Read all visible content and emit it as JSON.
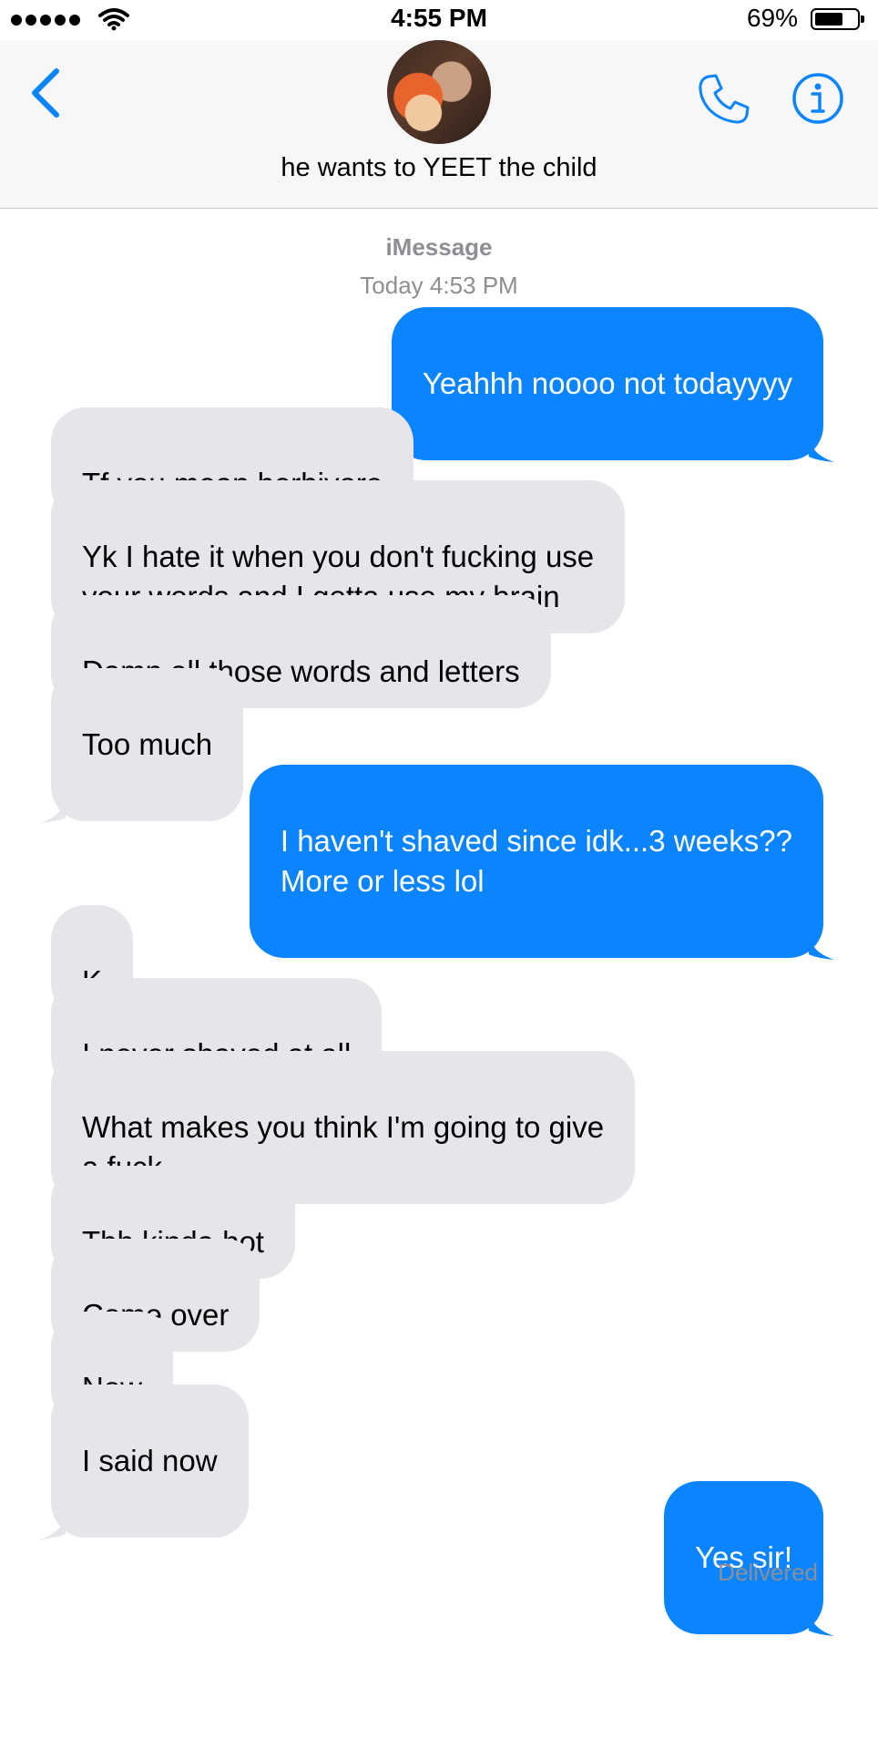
{
  "status_bar": {
    "time": "4:55 PM",
    "battery_percent": "69%",
    "battery_level": 0.69
  },
  "header": {
    "contact_name": "he wants to YEET the child"
  },
  "thread": {
    "service_label": "iMessage",
    "timestamp": "Today 4:53 PM"
  },
  "messages": [
    {
      "from": "me",
      "text": "Yeahhh noooo not todayyyy"
    },
    {
      "from": "them",
      "text": "Tf you mean herbivore"
    },
    {
      "from": "them",
      "text": "Yk I hate it when you don't fucking use\nyour words and I gotta use my brain"
    },
    {
      "from": "them",
      "text": "Damn all those words and letters"
    },
    {
      "from": "them",
      "text": "Too much"
    },
    {
      "from": "me",
      "text": "I haven't shaved since idk...3 weeks??\nMore or less lol"
    },
    {
      "from": "them",
      "text": "K"
    },
    {
      "from": "them",
      "text": "I never shaved at all"
    },
    {
      "from": "them",
      "text": "What makes you think I'm going to give\na fuck"
    },
    {
      "from": "them",
      "text": "Tbh kinda hot"
    },
    {
      "from": "them",
      "text": "Come over"
    },
    {
      "from": "them",
      "text": "Now"
    },
    {
      "from": "them",
      "text": "I said now"
    },
    {
      "from": "me",
      "text": "Yes sir!"
    }
  ],
  "delivery_status": "Delivered",
  "colors": {
    "accent": "#0a84ff",
    "incoming_bubble": "#e5e5ea",
    "meta_text": "#8e8e93"
  }
}
